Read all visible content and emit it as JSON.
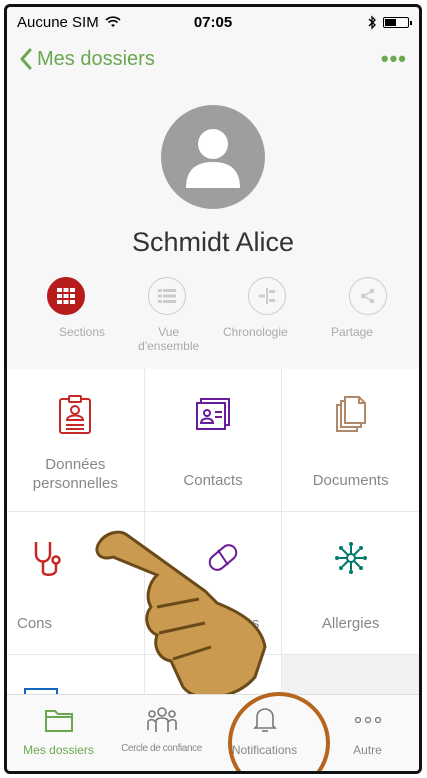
{
  "status": {
    "carrier": "Aucune SIM",
    "time": "07:05",
    "battery_level": 0.55
  },
  "nav": {
    "back_label": "Mes dossiers",
    "more_label": "•••"
  },
  "profile": {
    "name": "Schmidt Alice"
  },
  "views": [
    {
      "label": "Sections",
      "icon": "grid-icon",
      "active": true
    },
    {
      "label": "Vue d'ensemble",
      "icon": "list-icon",
      "active": false
    },
    {
      "label": "Chronologie",
      "icon": "timeline-icon",
      "active": false
    },
    {
      "label": "Partage",
      "icon": "share-icon",
      "active": false
    }
  ],
  "sections": [
    {
      "label": "Données personnelles",
      "icon": "personal-data-icon",
      "color": "#c62828"
    },
    {
      "label": "Contacts",
      "icon": "contacts-icon",
      "color": "#6a1b9a"
    },
    {
      "label": "Documents",
      "icon": "documents-icon",
      "color": "#b08968"
    },
    {
      "label": "Consultations",
      "visible_label": "Cons",
      "icon": "stethoscope-icon",
      "color": "#c62828"
    },
    {
      "label": "Médicaments",
      "visible_label": "caments",
      "icon": "pill-icon",
      "color": "#6a1b9a"
    },
    {
      "label": "Allergies",
      "icon": "allergy-icon",
      "color": "#00796b"
    }
  ],
  "tabs": [
    {
      "label": "Mes dossiers",
      "icon": "folder-icon",
      "active": true
    },
    {
      "label": "Cercle de confiance",
      "icon": "people-icon",
      "active": false
    },
    {
      "label": "Notifications",
      "icon": "bell-icon",
      "active": false
    },
    {
      "label": "Autre",
      "icon": "more-icon",
      "active": false
    }
  ],
  "colors": {
    "accent": "#6aa84f",
    "active_view": "#b71c1c",
    "highlight_ring": "#b5651d",
    "hand": "#c99a4f"
  }
}
